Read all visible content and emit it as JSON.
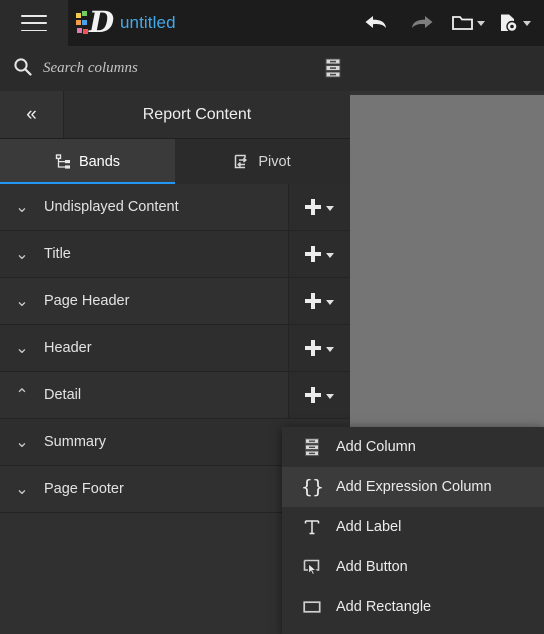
{
  "window": {
    "app_title": "untitled",
    "logo_letter": "D",
    "logo_colors": [
      "#f2c94c",
      "#6fcf63",
      "#f2994a",
      "#4aa3e8",
      "#e07bb0",
      "#eb5757"
    ],
    "accent_color": "#2196f3",
    "title_color": "#45a8e8"
  },
  "toolbar": {
    "items": [
      {
        "name": "undo-button",
        "icon": "undo-arrow-icon",
        "enabled": true
      },
      {
        "name": "redo-button",
        "icon": "redo-arrow-icon",
        "enabled": false
      },
      {
        "name": "open-folder-button",
        "icon": "folder-icon",
        "has_caret": true
      },
      {
        "name": "document-settings-button",
        "icon": "document-gear-icon",
        "has_caret": true
      }
    ],
    "hamburger_label": "menu-icon"
  },
  "search": {
    "placeholder": "Search columns",
    "value": "",
    "icon": "search-icon",
    "data_source_icon": "database-icon"
  },
  "panel": {
    "title": "Report Content",
    "collapse_glyph": "«",
    "tabs": [
      {
        "label": "Bands",
        "icon": "hierarchy-icon",
        "active": true
      },
      {
        "label": "Pivot",
        "icon": "pivot-rotate-icon",
        "active": false
      }
    ],
    "bands": [
      {
        "label": "Undisplayed Content",
        "expanded": false,
        "chevron": "⌄"
      },
      {
        "label": "Title",
        "expanded": false,
        "chevron": "⌄"
      },
      {
        "label": "Page Header",
        "expanded": false,
        "chevron": "⌄"
      },
      {
        "label": "Header",
        "expanded": false,
        "chevron": "⌄"
      },
      {
        "label": "Detail",
        "expanded": true,
        "chevron": "⌃"
      },
      {
        "label": "Summary",
        "expanded": false,
        "chevron": "⌄"
      },
      {
        "label": "Page Footer",
        "expanded": false,
        "chevron": "⌄"
      }
    ],
    "add_button_label": "+"
  },
  "context_menu": {
    "open_for_band": "Detail",
    "items": [
      {
        "label": "Add Column",
        "icon": "database-icon",
        "highlighted": false
      },
      {
        "label": "Add Expression Column",
        "icon": "braces-icon",
        "highlighted": true
      },
      {
        "label": "Add Label",
        "icon": "text-label-icon",
        "highlighted": false
      },
      {
        "label": "Add Button",
        "icon": "button-cursor-icon",
        "highlighted": false
      },
      {
        "label": "Add Rectangle",
        "icon": "rectangle-icon",
        "highlighted": false
      }
    ]
  }
}
